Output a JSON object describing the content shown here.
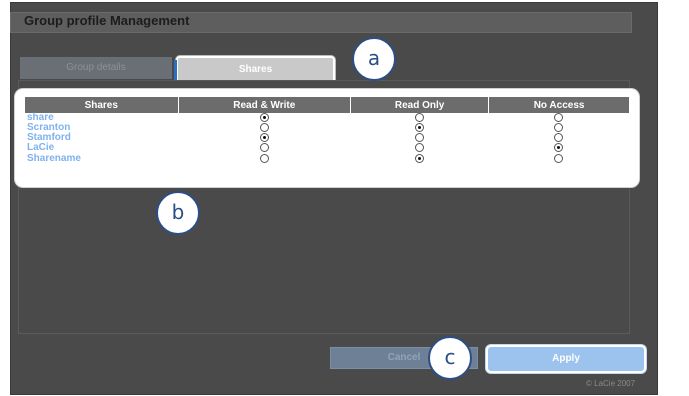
{
  "header": {
    "title": "Group profile Management"
  },
  "tabs": [
    {
      "label": "Group details",
      "active": false
    },
    {
      "label": "Shares",
      "active": true
    }
  ],
  "table": {
    "columns": [
      "Shares",
      "Read & Write",
      "Read Only",
      "No Access"
    ],
    "rows": [
      {
        "name": "share",
        "selected": "Read & Write"
      },
      {
        "name": "Scranton",
        "selected": "Read Only"
      },
      {
        "name": "Stamford",
        "selected": "Read & Write"
      },
      {
        "name": "LaCie",
        "selected": "No Access"
      },
      {
        "name": "Sharename",
        "selected": "Read Only"
      }
    ]
  },
  "buttons": {
    "cancel": "Cancel",
    "apply": "Apply"
  },
  "footer": {
    "copyright": "© LaCie 2007"
  },
  "callouts": {
    "a": "a",
    "b": "b",
    "c": "c"
  },
  "colors": {
    "panel_bg": "#4a4a4a",
    "active_tab": "#c9c9c9",
    "share_name": "#7fb2ee",
    "apply_button": "#9cc3ee"
  }
}
